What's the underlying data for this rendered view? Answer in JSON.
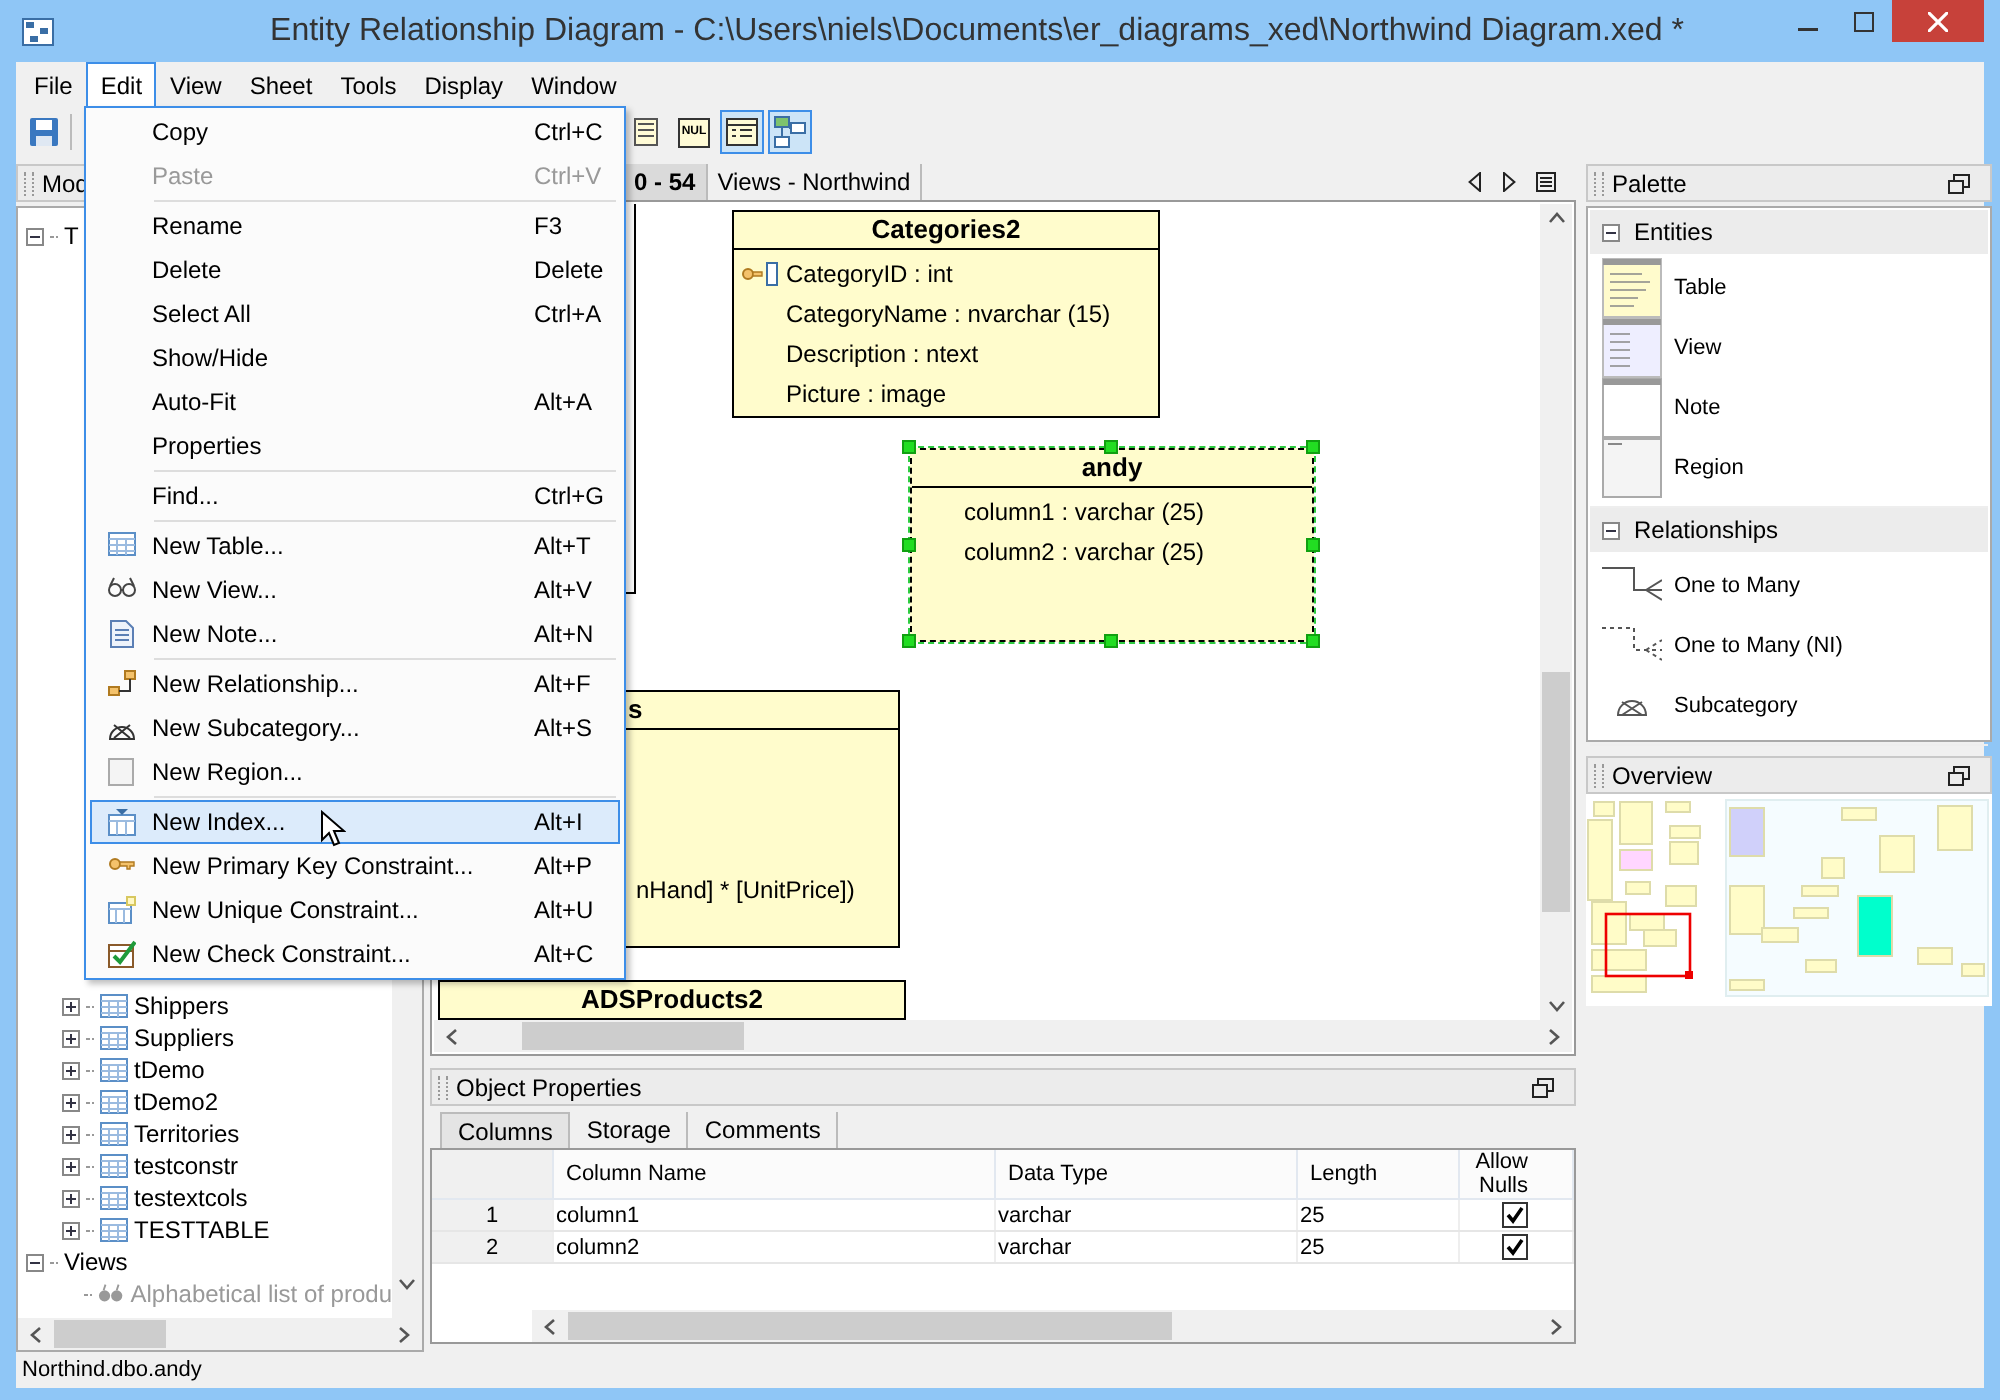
{
  "window": {
    "title": "Entity Relationship Diagram - C:\\Users\\niels\\Documents\\er_diagrams_xed\\Northwind Diagram.xed *"
  },
  "menubar": [
    {
      "label": "File",
      "selected": false
    },
    {
      "label": "Edit",
      "selected": true
    },
    {
      "label": "View",
      "selected": false
    },
    {
      "label": "Sheet",
      "selected": false
    },
    {
      "label": "Tools",
      "selected": false
    },
    {
      "label": "Display",
      "selected": false
    },
    {
      "label": "Window",
      "selected": false
    }
  ],
  "toolbar": [
    {
      "kind": "save",
      "selected": false
    },
    {
      "kind": "list",
      "selected": false
    },
    {
      "kind": "nul",
      "label": "NUL",
      "selected": false
    },
    {
      "kind": "details",
      "selected": true
    },
    {
      "kind": "diagram",
      "selected": true
    }
  ],
  "edit_menu": [
    {
      "kind": "item",
      "label": "Copy",
      "shortcut": "Ctrl+C",
      "disabled": false,
      "highlighted": false
    },
    {
      "kind": "item",
      "label": "Paste",
      "shortcut": "Ctrl+V",
      "disabled": true,
      "highlighted": false
    },
    {
      "kind": "separator"
    },
    {
      "kind": "item",
      "label": "Rename",
      "shortcut": "F3",
      "disabled": false,
      "highlighted": false
    },
    {
      "kind": "item",
      "label": "Delete",
      "shortcut": "Delete",
      "disabled": false,
      "highlighted": false
    },
    {
      "kind": "item",
      "label": "Select All",
      "shortcut": "Ctrl+A",
      "disabled": false,
      "highlighted": false
    },
    {
      "kind": "item",
      "label": "Show/Hide",
      "disabled": false,
      "highlighted": false
    },
    {
      "kind": "item",
      "label": "Auto-Fit",
      "shortcut": "Alt+A",
      "disabled": false,
      "highlighted": false
    },
    {
      "kind": "item",
      "label": "Properties",
      "disabled": false,
      "highlighted": false
    },
    {
      "kind": "separator"
    },
    {
      "kind": "item",
      "label": "Find...",
      "shortcut": "Ctrl+G",
      "disabled": false,
      "highlighted": false
    },
    {
      "kind": "separator"
    },
    {
      "kind": "item",
      "label": "New Table...",
      "shortcut": "Alt+T",
      "disabled": false,
      "highlighted": false
    },
    {
      "kind": "item",
      "label": "New View...",
      "shortcut": "Alt+V",
      "disabled": false,
      "highlighted": false
    },
    {
      "kind": "item",
      "label": "New Note...",
      "shortcut": "Alt+N",
      "disabled": false,
      "highlighted": false
    },
    {
      "kind": "separator"
    },
    {
      "kind": "item",
      "label": "New Relationship...",
      "shortcut": "Alt+F",
      "disabled": false,
      "highlighted": false
    },
    {
      "kind": "item",
      "label": "New Subcategory...",
      "shortcut": "Alt+S",
      "disabled": false,
      "highlighted": false
    },
    {
      "kind": "item",
      "label": "New Region...",
      "disabled": false,
      "highlighted": false
    },
    {
      "kind": "separator"
    },
    {
      "kind": "item",
      "label": "New Index...",
      "shortcut": "Alt+I",
      "disabled": false,
      "highlighted": true
    },
    {
      "kind": "item",
      "label": "New Primary Key Constraint...",
      "shortcut": "Alt+P",
      "disabled": false,
      "highlighted": false
    },
    {
      "kind": "item",
      "label": "New Unique Constraint...",
      "shortcut": "Alt+U",
      "disabled": false,
      "highlighted": false
    },
    {
      "kind": "item",
      "label": "New Check Constraint...",
      "shortcut": "Alt+C",
      "disabled": false,
      "highlighted": false
    }
  ],
  "model_panel": {
    "title": "Mod",
    "tree": [
      {
        "label": "T",
        "expanded": true,
        "children": [
          {
            "label": "Shippers",
            "kind": "table",
            "expanded": false
          },
          {
            "label": "Suppliers",
            "kind": "table",
            "expanded": false
          },
          {
            "label": "tDemo",
            "kind": "table",
            "expanded": false
          },
          {
            "label": "tDemo2",
            "kind": "table",
            "expanded": false
          },
          {
            "label": "Territories",
            "kind": "table",
            "expanded": false
          },
          {
            "label": "testconstr",
            "kind": "table",
            "expanded": false
          },
          {
            "label": "testextcols",
            "kind": "table",
            "expanded": false
          },
          {
            "label": "TESTTABLE",
            "kind": "table",
            "expanded": false
          }
        ]
      },
      {
        "label": "Views",
        "expanded": true,
        "children": [
          {
            "label": "Alphabetical list of produ",
            "kind": "view",
            "disabled": true
          }
        ]
      }
    ]
  },
  "diagram": {
    "tabs": [
      {
        "label": "0 - 54",
        "selected": true
      },
      {
        "label": "Views - Northwind",
        "selected": false
      }
    ],
    "entities": [
      {
        "selected": false
      },
      {
        "title": "Categories2",
        "selected": false,
        "columns": [
          {
            "text": "CategoryID : int",
            "key": true
          },
          {
            "text": "CategoryName : nvarchar (15)",
            "key": false
          },
          {
            "text": "Description : ntext",
            "key": false
          },
          {
            "text": "Picture : image",
            "key": false
          }
        ]
      },
      {
        "title": "andy",
        "selected": true,
        "columns": [
          {
            "text": "column1 : varchar (25)",
            "key": false
          },
          {
            "text": "column2 : varchar (25)",
            "key": false
          }
        ]
      },
      {
        "title": "s",
        "selected": false,
        "columns": [
          {
            "text": "nHand] * [UnitPrice])",
            "key": false
          }
        ]
      },
      {
        "title": "ADSProducts2",
        "selected": false
      }
    ]
  },
  "object_properties": {
    "title": "Object Properties",
    "tabs": [
      {
        "label": "Columns",
        "selected": true
      },
      {
        "label": "Storage",
        "selected": false
      },
      {
        "label": "Comments",
        "selected": false
      }
    ],
    "columns": [
      "Column Name",
      "Data Type",
      "Length",
      "Allow Nulls"
    ],
    "rows": [
      {
        "number": "1",
        "name": "column1",
        "type": "varchar",
        "length": "25",
        "allow_nulls": true
      },
      {
        "number": "2",
        "name": "column2",
        "type": "varchar",
        "length": "25",
        "allow_nulls": true
      }
    ]
  },
  "palette": {
    "title": "Palette",
    "groups": [
      {
        "title": "Entities",
        "expanded": true,
        "items": [
          {
            "kind": "table",
            "label": "Table"
          },
          {
            "kind": "view",
            "label": "View"
          },
          {
            "kind": "note",
            "label": "Note"
          },
          {
            "kind": "region",
            "label": "Region"
          }
        ]
      },
      {
        "title": "Relationships",
        "expanded": true,
        "items": [
          {
            "kind": "one_to_many",
            "label": "One to Many"
          },
          {
            "kind": "one_to_many_ni",
            "label": "One to Many (NI)"
          },
          {
            "kind": "subcategory",
            "label": "Subcategory"
          }
        ]
      }
    ]
  },
  "overview": {
    "title": "Overview"
  },
  "status_bar": {
    "text": "Northind.dbo.andy"
  }
}
